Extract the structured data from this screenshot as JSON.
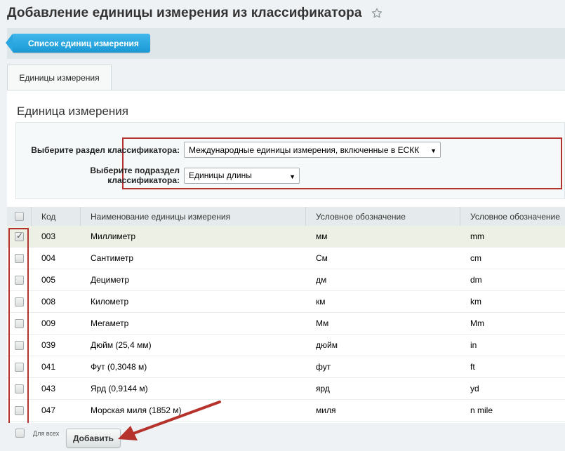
{
  "page": {
    "title": "Добавление единицы измерения из классификатора",
    "favorite_icon": "star-icon"
  },
  "toolbar": {
    "list_button": "Список единиц измерения"
  },
  "tabs": [
    {
      "label": "Единицы измерения",
      "active": true
    }
  ],
  "section": {
    "title": "Единица измерения"
  },
  "filter": {
    "section_label": "Выберите раздел классификатора:",
    "section_value": "Международные единицы измерения, включенные в ЕСКК",
    "subsection_label": "Выберите подраздел классификатора:",
    "subsection_value": "Единицы длины"
  },
  "grid": {
    "columns": [
      "Код",
      "Наименование единицы измерения",
      "Условное обозначение",
      "Условное обозначение"
    ],
    "rows": [
      {
        "code": "003",
        "name": "Миллиметр",
        "symbol": "мм",
        "symbol_intl": "mm",
        "checked": true
      },
      {
        "code": "004",
        "name": "Сантиметр",
        "symbol": "См",
        "symbol_intl": "cm",
        "checked": false
      },
      {
        "code": "005",
        "name": "Дециметр",
        "symbol": "дм",
        "symbol_intl": "dm",
        "checked": false
      },
      {
        "code": "008",
        "name": "Километр",
        "symbol": "км",
        "symbol_intl": "km",
        "checked": false
      },
      {
        "code": "009",
        "name": "Мегаметр",
        "symbol": "Мм",
        "symbol_intl": "Mm",
        "checked": false
      },
      {
        "code": "039",
        "name": "Дюйм (25,4 мм)",
        "symbol": "дюйм",
        "symbol_intl": "in",
        "checked": false
      },
      {
        "code": "041",
        "name": "Фут (0,3048 м)",
        "symbol": "фут",
        "symbol_intl": "ft",
        "checked": false
      },
      {
        "code": "043",
        "name": "Ярд (0,9144 м)",
        "symbol": "ярд",
        "symbol_intl": "yd",
        "checked": false
      },
      {
        "code": "047",
        "name": "Морская миля (1852 м)",
        "symbol": "миля",
        "symbol_intl": "n mile",
        "checked": false
      }
    ]
  },
  "footer": {
    "for_all_label": "Для всех",
    "add_button": "Добавить"
  },
  "colors": {
    "accent": "#1a99d6",
    "highlight": "#b6322c",
    "selected_row": "#edf0e4"
  }
}
